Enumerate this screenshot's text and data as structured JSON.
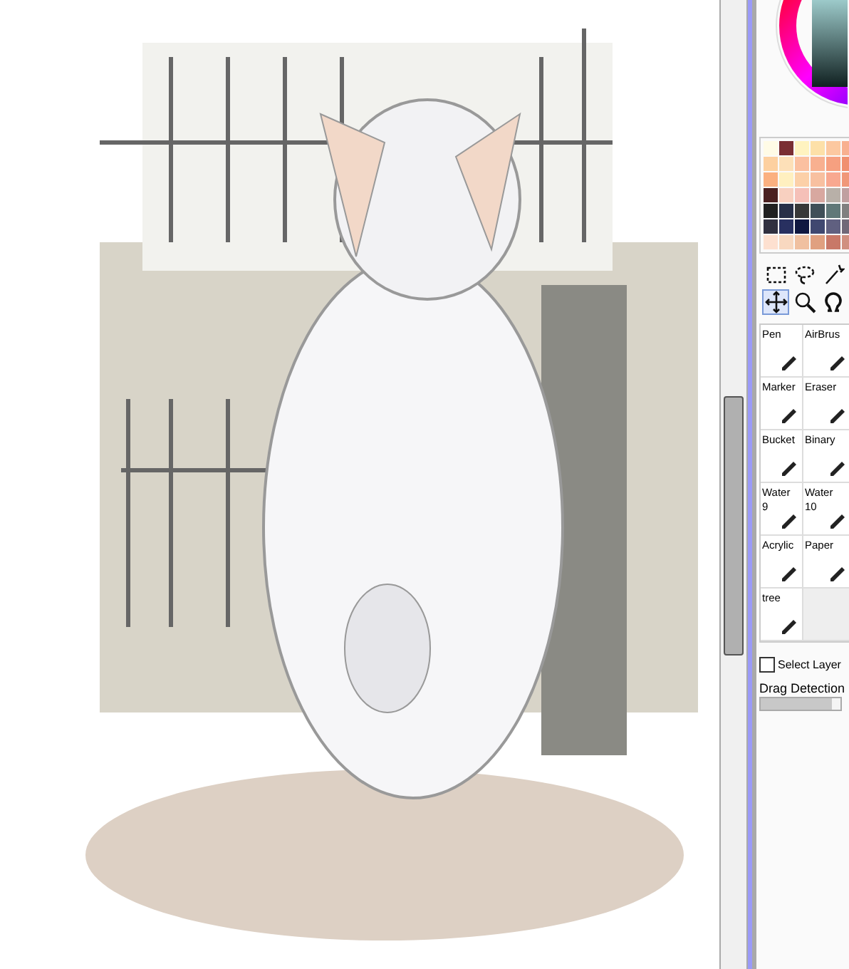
{
  "swatches": [
    {
      "color": "#fffbe6"
    },
    {
      "color": "#7a2e33"
    },
    {
      "color": "#fff3c0"
    },
    {
      "color": "#fde0a8"
    },
    {
      "color": "#fcc8a0"
    },
    {
      "color": "#f8b090"
    },
    {
      "color": "#fdd0a0"
    },
    {
      "color": "#fde0b8"
    },
    {
      "color": "#fbc0a0"
    },
    {
      "color": "#f8b090"
    },
    {
      "color": "#f6a080"
    },
    {
      "color": "#f09070"
    },
    {
      "color": "#fbb080"
    },
    {
      "color": "#fff0c0"
    },
    {
      "color": "#fcd0a8"
    },
    {
      "color": "#f8c0a0"
    },
    {
      "color": "#f8a890"
    },
    {
      "color": "#f09878"
    },
    {
      "color": "#4a2020"
    },
    {
      "color": "#f8d0c0"
    },
    {
      "color": "#f5c0b8"
    },
    {
      "color": "#d8a8a0"
    },
    {
      "color": "#b8b0a8"
    },
    {
      "color": "#c0a0a0"
    },
    {
      "color": "#202020"
    },
    {
      "color": "#283048"
    },
    {
      "color": "#383838"
    },
    {
      "color": "#405058"
    },
    {
      "color": "#607878"
    },
    {
      "color": "#808080"
    },
    {
      "color": "#303040"
    },
    {
      "color": "#283060"
    },
    {
      "color": "#101840"
    },
    {
      "color": "#404870"
    },
    {
      "color": "#606080"
    },
    {
      "color": "#706878"
    },
    {
      "color": "#fde0d0"
    },
    {
      "color": "#f8d8c0"
    },
    {
      "color": "#f0c0a0"
    },
    {
      "color": "#e0a080"
    },
    {
      "color": "#c87868"
    },
    {
      "color": "#d09080"
    }
  ],
  "tools": [
    {
      "kind": "select",
      "selected": false
    },
    {
      "kind": "lasso",
      "selected": false
    },
    {
      "kind": "wand",
      "selected": false
    },
    {
      "kind": "move",
      "selected": true
    },
    {
      "kind": "zoom",
      "selected": false
    },
    {
      "kind": "rotate",
      "selected": false
    }
  ],
  "brushes": [
    {
      "label": "Pen"
    },
    {
      "label": "AirBrus"
    },
    {
      "label": "Marker"
    },
    {
      "label": "Eraser"
    },
    {
      "label": "Bucket"
    },
    {
      "label": "Binary"
    },
    {
      "label": "Water",
      "size": "9"
    },
    {
      "label": "Water",
      "size": "10"
    },
    {
      "label": "Acrylic"
    },
    {
      "label": "Paper"
    },
    {
      "label": "tree"
    }
  ],
  "select_layer": {
    "label": "Select Layer",
    "checked": false
  },
  "drag_detection": {
    "label": "Drag Detection",
    "level": 0.9
  }
}
